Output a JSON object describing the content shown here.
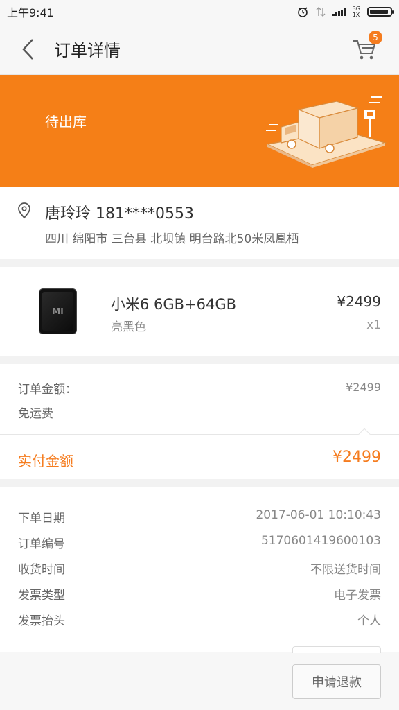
{
  "status_bar": {
    "time": "上午9:41",
    "network_top": "3G",
    "network_bottom": "1X"
  },
  "header": {
    "title": "订单详情",
    "cart_badge": "5"
  },
  "banner": {
    "status": "待出库",
    "color": "#f57f17"
  },
  "address": {
    "recipient": "唐玲玲 181****0553",
    "line": "四川 绵阳市 三台县 北坝镇 明台路北50米凤凰栖"
  },
  "product": {
    "name": "小米6 6GB+64GB",
    "color": "亮黑色",
    "price": "¥2499",
    "quantity": "x1",
    "logo": "MI"
  },
  "amounts": {
    "order_amount_label": "订单金额：",
    "order_amount_value": "¥2499",
    "shipping_label": "免运费",
    "paid_label": "实付金额",
    "paid_value": "¥2499",
    "accent_color": "#f57c1f"
  },
  "info": {
    "rows": [
      {
        "label": "下单日期",
        "value": "2017-06-01 10:10:43"
      },
      {
        "label": "订单编号",
        "value": "5170601419600103"
      },
      {
        "label": "收货时间",
        "value": "不限送货时间"
      },
      {
        "label": "发票类型",
        "value": "电子发票"
      },
      {
        "label": "发票抬头",
        "value": "个人"
      }
    ]
  },
  "bottom": {
    "refund_label": "申请退款"
  }
}
